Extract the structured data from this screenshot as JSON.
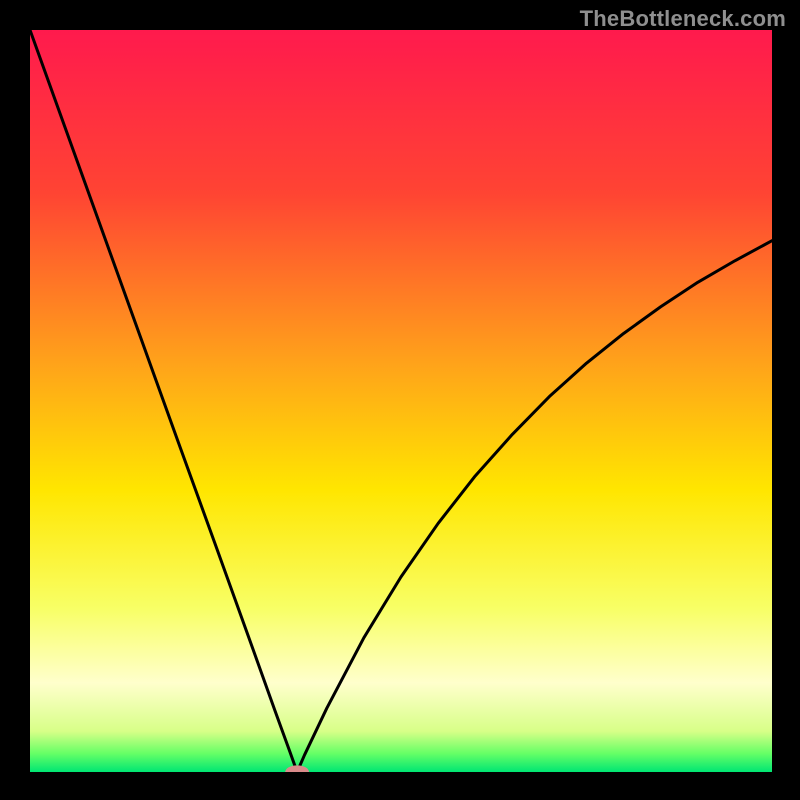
{
  "watermark": "TheBottleneck.com",
  "colors": {
    "background": "#000000",
    "watermark": "#8f8f8f",
    "curve": "#000000",
    "marker_fill": "#d98a8a"
  },
  "chart_data": {
    "type": "line",
    "title": "",
    "xlabel": "",
    "ylabel": "",
    "xlim": [
      0,
      100
    ],
    "ylim": [
      0,
      100
    ],
    "grid": false,
    "series": [
      {
        "name": "bottleneck-curve",
        "x": [
          0,
          5,
          10,
          15,
          20,
          25,
          30,
          33,
          35,
          36,
          37,
          40,
          45,
          50,
          55,
          60,
          65,
          70,
          75,
          80,
          85,
          90,
          95,
          100
        ],
        "values": [
          100,
          86.1,
          72.2,
          58.3,
          44.4,
          30.6,
          16.7,
          8.3,
          2.8,
          0,
          2.3,
          8.6,
          18.1,
          26.3,
          33.5,
          39.9,
          45.5,
          50.6,
          55.1,
          59.1,
          62.7,
          66.0,
          68.9,
          71.6
        ]
      }
    ],
    "marker": {
      "x": 36,
      "y": 0,
      "rx": 1.6,
      "ry": 0.9
    },
    "gradient_stops": [
      {
        "offset": 0.0,
        "color": "#ff1a4d"
      },
      {
        "offset": 0.22,
        "color": "#ff4433"
      },
      {
        "offset": 0.45,
        "color": "#ffa31a"
      },
      {
        "offset": 0.62,
        "color": "#ffe600"
      },
      {
        "offset": 0.78,
        "color": "#f8ff66"
      },
      {
        "offset": 0.88,
        "color": "#ffffcc"
      },
      {
        "offset": 0.945,
        "color": "#d8ff88"
      },
      {
        "offset": 0.975,
        "color": "#66ff66"
      },
      {
        "offset": 1.0,
        "color": "#00e673"
      }
    ]
  }
}
